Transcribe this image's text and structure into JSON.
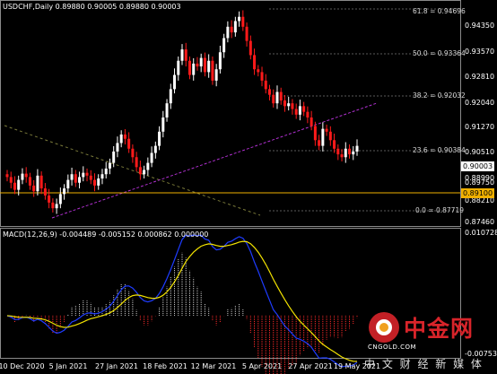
{
  "window": {
    "symbol_header": "USDCHF,Daily  0.89880 0.90005 0.89880 0.90003"
  },
  "macd": {
    "header": "MACD(12,26,9) -0.004489 -0.005152 0.000862 0.000000",
    "axis_top": "0.010728",
    "axis_bottom": "-0.007531",
    "colors": {
      "histogram_pos": "#c8c8c8",
      "histogram_neg": "#ff2a2a",
      "macd_line": "#1e3cff",
      "signal_line": "#f2e200"
    }
  },
  "price_axis": [
    "0.94350",
    "0.93570",
    "0.92810",
    "0.92040",
    "0.91270",
    "0.90510",
    "0.89750",
    "0.88990",
    "0.88210",
    "0.87460"
  ],
  "current_price": "0.90003",
  "level_price": "0.89100",
  "fibonacci": [
    {
      "label": "61.8 = 0.94696"
    },
    {
      "label": "50.0 = 0.93364"
    },
    {
      "label": "38.2 = 0.92032"
    },
    {
      "label": "23.6 = 0.90384"
    },
    {
      "label": "0.0 = 0.87719"
    }
  ],
  "dates": [
    "10 Dec 2020",
    "5 Jan 2021",
    "27 Jan 2021",
    "18 Feb 2021",
    "12 Mar 2021",
    "5 Apr 2021",
    "27 Apr 2021",
    "19 May 2021"
  ],
  "watermark": {
    "brand": "中金网",
    "sub_cn": "中 文 财 经 新 媒 体",
    "sub_en": "CNGOLD.COM"
  },
  "colors": {
    "bull_candle": "#ffffff",
    "bear_candle": "#ff1a1a",
    "level_line": "#f0b000",
    "trend_line": "#b030d0",
    "price_badge_bg": "#ffffff",
    "level_badge_bg": "#f0b000",
    "logo_red": "#d8242a"
  },
  "chart_data": {
    "type": "candlestick",
    "series_close": [
      0.889,
      0.887,
      0.8845,
      0.888,
      0.8902,
      0.889,
      0.886,
      0.884,
      0.8895,
      0.885,
      0.8825,
      0.88,
      0.878,
      0.8795,
      0.883,
      0.885,
      0.888,
      0.89,
      0.887,
      0.889,
      0.8905,
      0.8895,
      0.888,
      0.886,
      0.8885,
      0.89,
      0.892,
      0.894,
      0.898,
      0.901,
      0.904,
      0.9025,
      0.899,
      0.896,
      0.8925,
      0.89,
      0.8915,
      0.894,
      0.8975,
      0.9,
      0.905,
      0.91,
      0.915,
      0.92,
      0.925,
      0.93,
      0.934,
      0.93,
      0.925,
      0.929,
      0.928,
      0.931,
      0.926,
      0.93,
      0.923,
      0.927,
      0.933,
      0.938,
      0.942,
      0.94,
      0.944,
      0.9455,
      0.942,
      0.937,
      0.932,
      0.927,
      0.926,
      0.923,
      0.92,
      0.918,
      0.915,
      0.919,
      0.916,
      0.914,
      0.915,
      0.913,
      0.911,
      0.914,
      0.912,
      0.91,
      0.907,
      0.902,
      0.9,
      0.906,
      0.905,
      0.902,
      0.899,
      0.897,
      0.896,
      0.899,
      0.897,
      0.898,
      0.9
    ],
    "ylim": [
      0.873,
      0.947
    ]
  }
}
